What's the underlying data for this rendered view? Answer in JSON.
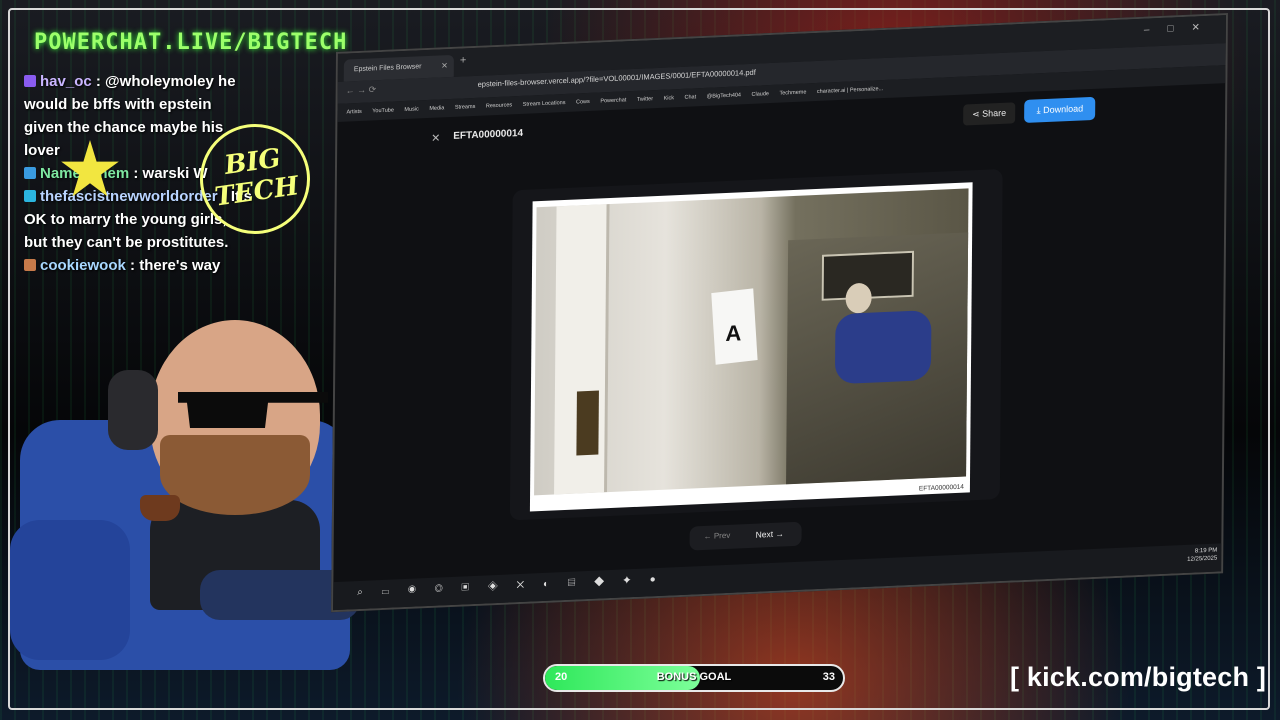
{
  "overlay": {
    "brand": "POWERCHAT.LIVE/BIGTECH",
    "stamp": "BIG TECH",
    "kick_link": "[ kick.com/bigtech ]",
    "goal": {
      "start": "20",
      "label": "BONUS GOAL",
      "end": "33",
      "progress": 0.52
    }
  },
  "chat": [
    {
      "user": "hav_oc",
      "text": ": @wholeymoley he would be bffs with epstein given the chance maybe his lover"
    },
    {
      "user": "Name_Them",
      "text": ": warski W"
    },
    {
      "user": "thefascistnewworldorder",
      "text": ": It's OK to marry the young girls, but they can't be prostitutes."
    },
    {
      "user": "cookiewook",
      "text": ": there's way"
    }
  ],
  "browser": {
    "tab_title": "Epstein Files Browser",
    "url": "epstein-files-browser.vercel.app/?file=VOL00001/IMAGES/0001/EFTA00000014.pdf",
    "bookmarks": [
      "Artists",
      "YouTube",
      "Music",
      "Media",
      "Streams",
      "Resources",
      "Stream Locations",
      "Cows",
      "Powerchat",
      "Twitter",
      "Kick",
      "Chat",
      "@BigTech404",
      "Claude",
      "Techmeme",
      "character.ai | Personalize..."
    ],
    "doc_title": "EFTA00000014",
    "share_label": "Share",
    "download_label": "Download",
    "page_id": "EFTA00000014",
    "prev_label": "Prev",
    "next_label": "Next",
    "clock_time": "8:19 PM",
    "clock_date": "12/25/2025"
  },
  "colors": {
    "brand_green": "#9cff6a",
    "download_blue": "#2f8ff0",
    "goal_green": "#2ee85a"
  }
}
